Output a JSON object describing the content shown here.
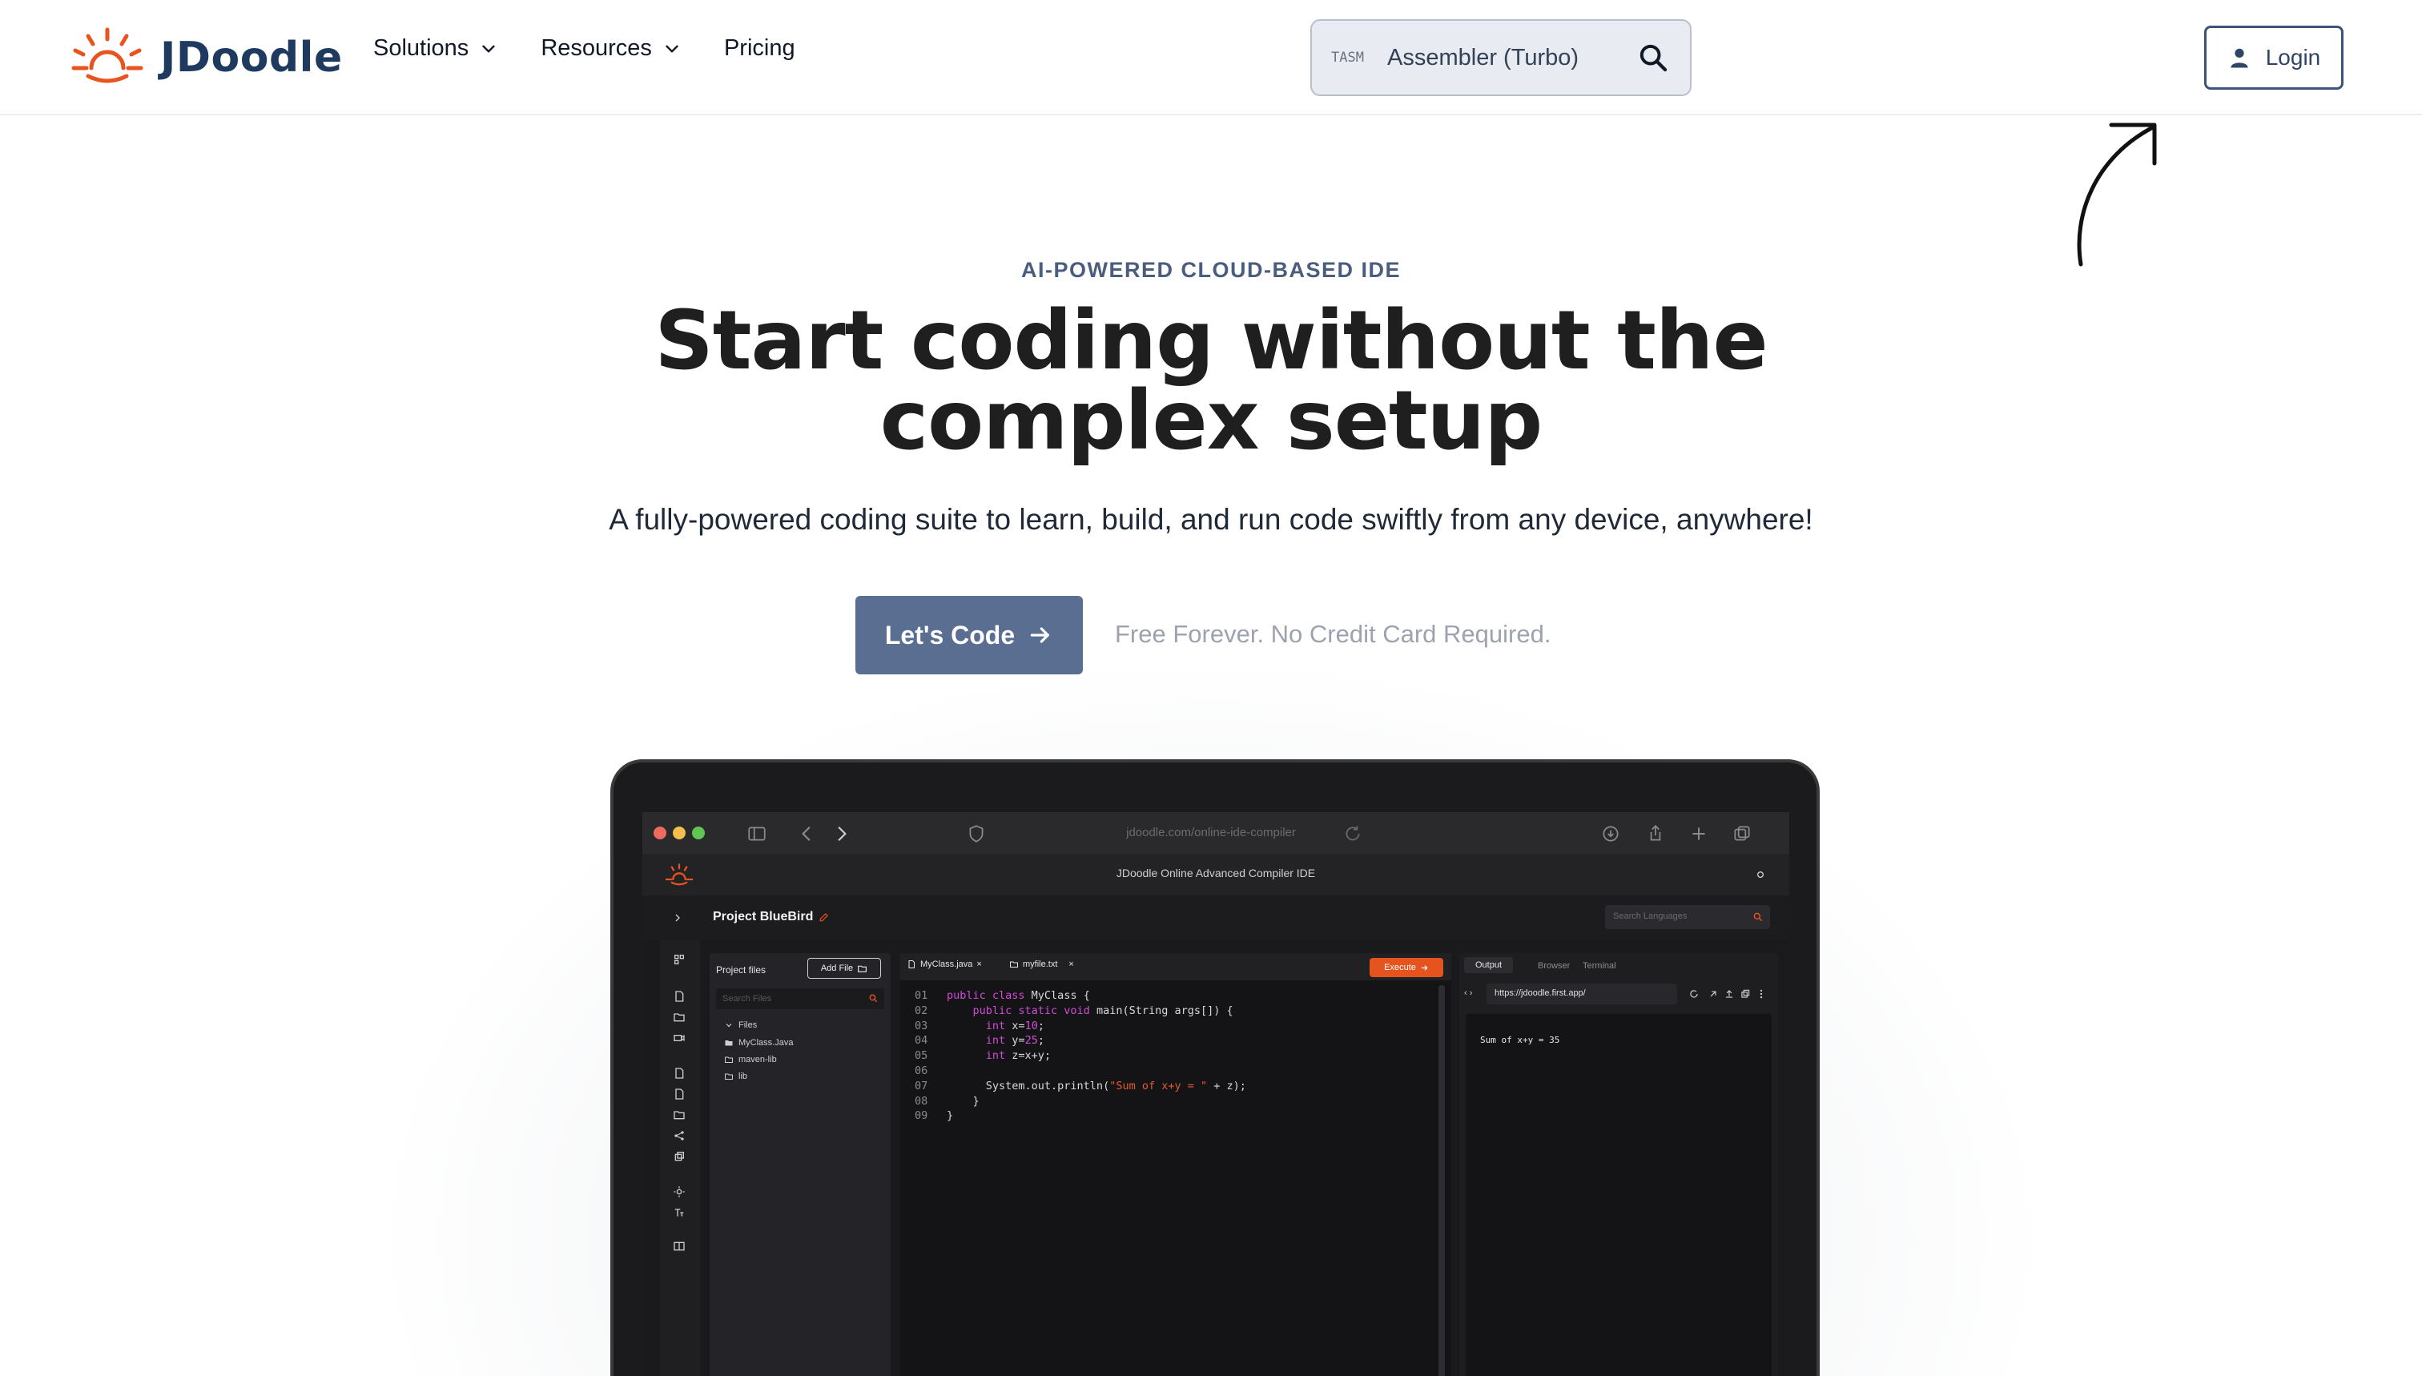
{
  "brand": {
    "name": "JDoodle",
    "accent": "#e8531f",
    "navy": "#1e3a5f"
  },
  "nav": {
    "items": [
      {
        "label": "Solutions",
        "has_dropdown": true
      },
      {
        "label": "Resources",
        "has_dropdown": true
      },
      {
        "label": "Pricing",
        "has_dropdown": false
      }
    ]
  },
  "search": {
    "tag": "TASM",
    "value": "Assembler (Turbo)",
    "icon": "search-icon"
  },
  "login": {
    "label": "Login",
    "icon": "user-icon"
  },
  "hero": {
    "eyebrow": "AI-POWERED CLOUD-BASED IDE",
    "headline_line1": "Start coding without the",
    "headline_line2": "complex setup",
    "subhead": "A fully-powered coding suite to learn, build, and run code swiftly from any device, anywhere!",
    "cta_label": "Let's Code",
    "cta_note": "Free Forever. No Credit Card Required."
  },
  "mockup": {
    "url": "jdoodle.com/online-ide-compiler",
    "app_title": "JDoodle Online Advanced Compiler IDE",
    "project_title": "Project BlueBird",
    "language_search_placeholder": "Search Languages",
    "files_panel": {
      "title": "Project files",
      "add_file_label": "Add File",
      "search_placeholder": "Search Files",
      "tree": [
        "Files",
        "MyClass.Java",
        "maven-lib",
        "lib"
      ]
    },
    "editor": {
      "tabs": [
        "MyClass.java",
        "myfile.txt"
      ],
      "execute_label": "Execute",
      "line_numbers": [
        "01",
        "02",
        "03",
        "04",
        "05",
        "06",
        "07",
        "08",
        "09"
      ]
    },
    "output": {
      "tabs": [
        "Output",
        "Browser",
        "Terminal"
      ],
      "url": "https://jdoodle.first.app/",
      "result": "Sum of x+y = 35"
    }
  }
}
